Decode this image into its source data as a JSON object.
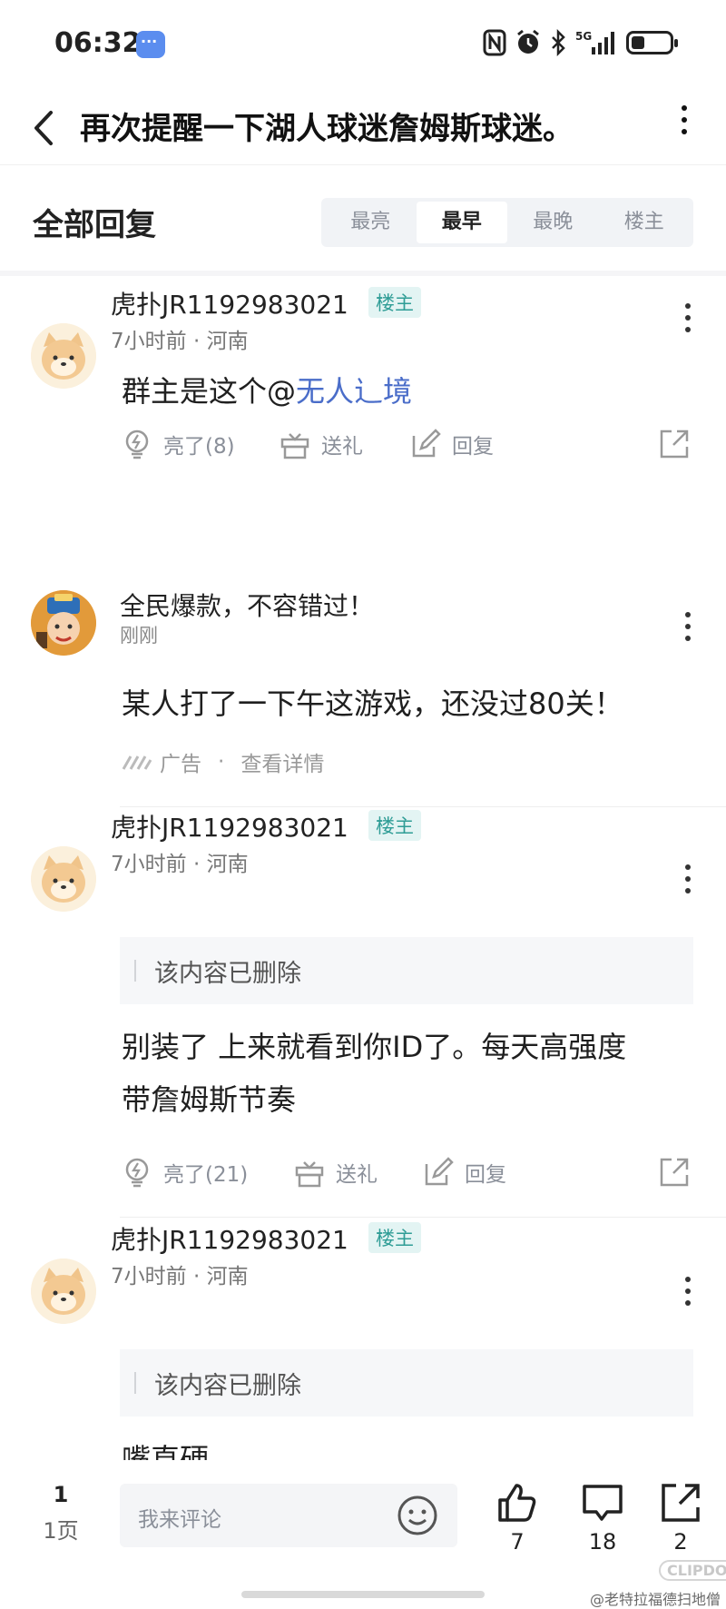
{
  "status_bar": {
    "time": "06:32",
    "network": "5G",
    "icons": [
      "message-bubble-icon",
      "nfc-icon",
      "alarm-icon",
      "bluetooth-icon",
      "signal-icon",
      "battery-icon"
    ]
  },
  "title_bar": {
    "title": "再次提醒一下湖人球迷詹姆斯球迷。"
  },
  "replies_header": {
    "title": "全部回复",
    "sort_tabs": [
      "最亮",
      "最早",
      "最晚",
      "楼主"
    ],
    "active_tab": "最早"
  },
  "posts": [
    {
      "username": "虎扑JR1192983021",
      "badge": "楼主",
      "meta": "7小时前 · 河南",
      "content_prefix": "群主是这个@",
      "mention": "无人辶境",
      "actions": {
        "like": "亮了(8)",
        "gift": "送礼",
        "reply": "回复"
      }
    },
    {
      "ad_title": "全民爆款，不容错过！",
      "ad_meta": "刚刚",
      "content": "某人打了一下午这游戏，还没过80关！",
      "ad_label": "广告",
      "ad_details": "查看详情"
    },
    {
      "username": "虎扑JR1192983021",
      "badge": "楼主",
      "meta": "7小时前 · 河南",
      "quoted": "该内容已删除",
      "content_line1": "别装了 上来就看到你ID了。每天高强度",
      "content_line2": "带詹姆斯节奏",
      "actions": {
        "like": "亮了(21)",
        "gift": "送礼",
        "reply": "回复"
      }
    },
    {
      "username": "虎扑JR1192983021",
      "badge": "楼主",
      "meta": "7小时前 · 河南",
      "quoted": "该内容已删除",
      "content": "嘴直硬"
    }
  ],
  "bottom_bar": {
    "current_page": "1",
    "total_pages": "1页",
    "comment_placeholder": "我来评论",
    "like_count": "7",
    "comment_count": "18",
    "share_count": "2"
  },
  "watermark": "@老特拉福德扫地僧",
  "watermark_logo": "CLIPDO"
}
